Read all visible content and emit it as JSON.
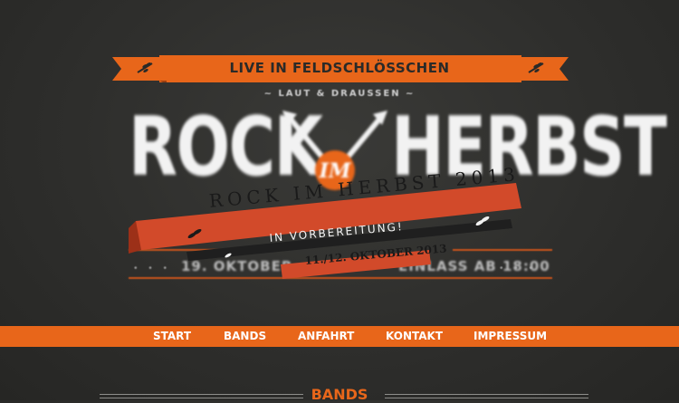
{
  "header": {
    "venue": "LIVE IN FELDSCHLÖSSCHEN",
    "tagline": "~ LAUT & DRAUSSEN ~",
    "logo_left": "ROCK",
    "logo_mid": "IM",
    "logo_right": "HERBST",
    "date_left": "19. OKTOBER",
    "date_right": "EINLASS AB 18:00"
  },
  "banner": {
    "title": "ROCK IM HERBST 2013",
    "status": "IN VORBEREITUNG!",
    "date": "11./12. OKTOBER 2013"
  },
  "nav": {
    "items": [
      "START",
      "BANDS",
      "ANFAHRT",
      "KONTAKT",
      "IMPRESSUM"
    ]
  },
  "section": {
    "title": "BANDS"
  },
  "colors": {
    "accent": "#e8661a",
    "banner_red": "#d24a2a",
    "background": "#2f2f2d"
  }
}
